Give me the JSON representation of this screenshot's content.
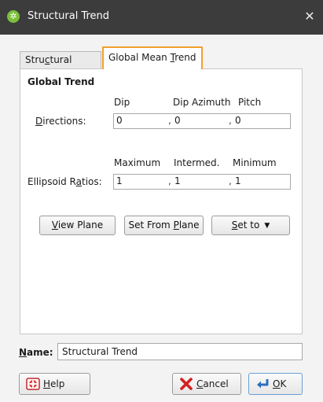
{
  "window": {
    "title": "Structural Trend"
  },
  "tabs": [
    {
      "label": "Structural Trend"
    },
    {
      "label": "Global Mean Trend",
      "selected": true
    }
  ],
  "global_trend": {
    "heading": "Global Trend",
    "column_headers": {
      "dip": "Dip",
      "dip_azimuth": "Dip Azimuth",
      "pitch": "Pitch"
    },
    "directions": {
      "label": "Directions:",
      "dip": "0",
      "dip_azimuth": "0",
      "pitch": "0"
    },
    "ratio_headers": {
      "maximum": "Maximum",
      "intermediate": "Intermed.",
      "minimum": "Minimum"
    },
    "ellipsoid_ratios": {
      "label": "Ellipsoid Ratios:",
      "maximum": "1",
      "intermediate": "1",
      "minimum": "1"
    },
    "separator": ","
  },
  "actions": {
    "view_plane": "View Plane",
    "set_from_plane": "Set From Plane",
    "set_to": "Set to"
  },
  "name_field": {
    "label": "Name:",
    "value": "Structural Trend"
  },
  "footer": {
    "help": "Help",
    "cancel": "Cancel",
    "ok": "OK"
  },
  "icons": {
    "app": "leapfrog-app-icon",
    "close": "close-icon",
    "help": "help-lifebuoy-icon",
    "cancel": "red-x-icon",
    "ok": "blue-return-arrow-icon",
    "dropdown": "chevron-down-icon"
  },
  "colors": {
    "titlebar": "#3c3c3c",
    "active_tab_outline": "#f0a02c",
    "ok_border": "#6a9fd6"
  }
}
